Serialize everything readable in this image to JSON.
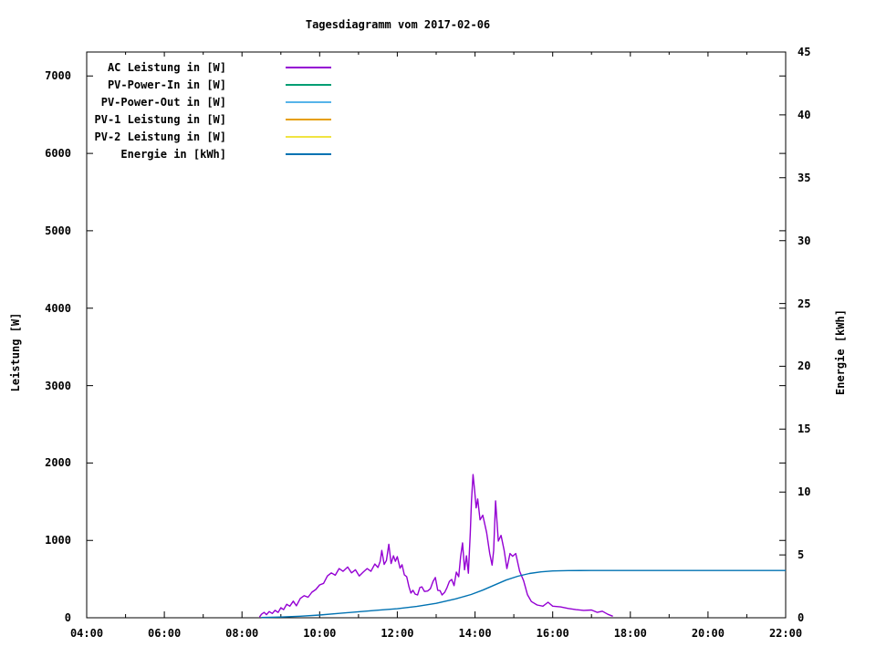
{
  "chart_data": {
    "type": "line",
    "title": "Tagesdiagramm vom 2017-02-06",
    "y1label": "Leistung [W]",
    "y2label": "Energie [kWh]",
    "background": "#ffffff",
    "grid": false,
    "legend_position": "top-left-inside",
    "x_range": [
      4,
      22
    ],
    "y1_range": [
      0,
      7310
    ],
    "y2_range": [
      0,
      45
    ],
    "x_ticks": [
      {
        "v": 4,
        "label": "04:00"
      },
      {
        "v": 6,
        "label": "06:00"
      },
      {
        "v": 8,
        "label": "08:00"
      },
      {
        "v": 10,
        "label": "10:00"
      },
      {
        "v": 12,
        "label": "12:00"
      },
      {
        "v": 14,
        "label": "14:00"
      },
      {
        "v": 16,
        "label": "16:00"
      },
      {
        "v": 18,
        "label": "18:00"
      },
      {
        "v": 20,
        "label": "20:00"
      },
      {
        "v": 22,
        "label": "22:00"
      }
    ],
    "x_minor": [
      5,
      7,
      9,
      11,
      13,
      15,
      17,
      19,
      21
    ],
    "y1_ticks": [
      {
        "v": 0,
        "label": "0"
      },
      {
        "v": 1000,
        "label": "1000"
      },
      {
        "v": 2000,
        "label": "2000"
      },
      {
        "v": 3000,
        "label": "3000"
      },
      {
        "v": 4000,
        "label": "4000"
      },
      {
        "v": 5000,
        "label": "5000"
      },
      {
        "v": 6000,
        "label": "6000"
      },
      {
        "v": 7000,
        "label": "7000"
      }
    ],
    "y2_ticks": [
      {
        "v": 0,
        "label": "0"
      },
      {
        "v": 5,
        "label": "5"
      },
      {
        "v": 10,
        "label": "10"
      },
      {
        "v": 15,
        "label": "15"
      },
      {
        "v": 20,
        "label": "20"
      },
      {
        "v": 25,
        "label": "25"
      },
      {
        "v": 30,
        "label": "30"
      },
      {
        "v": 35,
        "label": "35"
      },
      {
        "v": 40,
        "label": "40"
      },
      {
        "v": 45,
        "label": "45"
      }
    ],
    "series": [
      {
        "name": "AC Leistung in [W]",
        "color": "#9400D3",
        "axis": "y1",
        "points": [
          [
            8.45,
            10
          ],
          [
            8.5,
            45
          ],
          [
            8.57,
            70
          ],
          [
            8.63,
            40
          ],
          [
            8.7,
            80
          ],
          [
            8.78,
            55
          ],
          [
            8.85,
            95
          ],
          [
            8.93,
            70
          ],
          [
            9.0,
            130
          ],
          [
            9.07,
            105
          ],
          [
            9.15,
            175
          ],
          [
            9.23,
            150
          ],
          [
            9.32,
            215
          ],
          [
            9.4,
            155
          ],
          [
            9.5,
            250
          ],
          [
            9.6,
            285
          ],
          [
            9.7,
            265
          ],
          [
            9.8,
            330
          ],
          [
            9.9,
            365
          ],
          [
            10.0,
            425
          ],
          [
            10.1,
            445
          ],
          [
            10.2,
            540
          ],
          [
            10.3,
            580
          ],
          [
            10.4,
            550
          ],
          [
            10.5,
            635
          ],
          [
            10.6,
            600
          ],
          [
            10.72,
            655
          ],
          [
            10.82,
            580
          ],
          [
            10.92,
            620
          ],
          [
            11.02,
            540
          ],
          [
            11.12,
            590
          ],
          [
            11.22,
            635
          ],
          [
            11.32,
            600
          ],
          [
            11.42,
            695
          ],
          [
            11.5,
            650
          ],
          [
            11.56,
            730
          ],
          [
            11.6,
            870
          ],
          [
            11.66,
            690
          ],
          [
            11.72,
            740
          ],
          [
            11.78,
            950
          ],
          [
            11.84,
            700
          ],
          [
            11.9,
            800
          ],
          [
            11.95,
            730
          ],
          [
            12.0,
            790
          ],
          [
            12.07,
            640
          ],
          [
            12.12,
            685
          ],
          [
            12.18,
            555
          ],
          [
            12.24,
            530
          ],
          [
            12.3,
            400
          ],
          [
            12.35,
            320
          ],
          [
            12.4,
            355
          ],
          [
            12.46,
            305
          ],
          [
            12.52,
            295
          ],
          [
            12.58,
            390
          ],
          [
            12.63,
            400
          ],
          [
            12.7,
            340
          ],
          [
            12.78,
            345
          ],
          [
            12.85,
            375
          ],
          [
            12.92,
            470
          ],
          [
            12.98,
            520
          ],
          [
            13.04,
            355
          ],
          [
            13.1,
            350
          ],
          [
            13.15,
            295
          ],
          [
            13.22,
            330
          ],
          [
            13.28,
            390
          ],
          [
            13.34,
            470
          ],
          [
            13.4,
            495
          ],
          [
            13.46,
            415
          ],
          [
            13.52,
            590
          ],
          [
            13.58,
            530
          ],
          [
            13.63,
            790
          ],
          [
            13.68,
            967
          ],
          [
            13.73,
            620
          ],
          [
            13.78,
            800
          ],
          [
            13.83,
            575
          ],
          [
            13.88,
            1100
          ],
          [
            13.91,
            1510
          ],
          [
            13.95,
            1850
          ],
          [
            13.99,
            1650
          ],
          [
            14.03,
            1420
          ],
          [
            14.07,
            1535
          ],
          [
            14.13,
            1265
          ],
          [
            14.2,
            1325
          ],
          [
            14.3,
            1100
          ],
          [
            14.38,
            830
          ],
          [
            14.44,
            680
          ],
          [
            14.48,
            870
          ],
          [
            14.53,
            1510
          ],
          [
            14.6,
            990
          ],
          [
            14.67,
            1065
          ],
          [
            14.75,
            870
          ],
          [
            14.82,
            635
          ],
          [
            14.9,
            830
          ],
          [
            14.97,
            795
          ],
          [
            15.05,
            830
          ],
          [
            15.15,
            600
          ],
          [
            15.25,
            480
          ],
          [
            15.35,
            300
          ],
          [
            15.45,
            210
          ],
          [
            15.6,
            165
          ],
          [
            15.75,
            150
          ],
          [
            15.88,
            200
          ],
          [
            16.0,
            150
          ],
          [
            16.2,
            140
          ],
          [
            16.4,
            120
          ],
          [
            16.6,
            105
          ],
          [
            16.8,
            95
          ],
          [
            17.0,
            100
          ],
          [
            17.15,
            70
          ],
          [
            17.28,
            85
          ],
          [
            17.42,
            45
          ],
          [
            17.55,
            20
          ]
        ]
      },
      {
        "name": "PV-Power-In in [W]",
        "color": "#009E73",
        "axis": "y1",
        "points": []
      },
      {
        "name": "PV-Power-Out in [W]",
        "color": "#56B4E9",
        "axis": "y1",
        "points": []
      },
      {
        "name": "PV-1 Leistung in [W]",
        "color": "#E69F00",
        "axis": "y1",
        "points": []
      },
      {
        "name": "PV-2 Leistung in [W]",
        "color": "#F0E442",
        "axis": "y1",
        "points": []
      },
      {
        "name": "Energie in [kWh]",
        "color": "#0072B2",
        "axis": "y2",
        "points": [
          [
            8.5,
            0.02
          ],
          [
            9.0,
            0.06
          ],
          [
            9.5,
            0.12
          ],
          [
            10.0,
            0.22
          ],
          [
            10.5,
            0.35
          ],
          [
            11.0,
            0.48
          ],
          [
            11.5,
            0.6
          ],
          [
            12.0,
            0.72
          ],
          [
            12.5,
            0.9
          ],
          [
            13.0,
            1.15
          ],
          [
            13.5,
            1.5
          ],
          [
            13.9,
            1.85
          ],
          [
            14.2,
            2.2
          ],
          [
            14.5,
            2.6
          ],
          [
            14.8,
            3.0
          ],
          [
            15.1,
            3.3
          ],
          [
            15.4,
            3.52
          ],
          [
            15.7,
            3.65
          ],
          [
            16.0,
            3.72
          ],
          [
            16.4,
            3.75
          ],
          [
            17.0,
            3.76
          ],
          [
            18.0,
            3.76
          ],
          [
            20.0,
            3.76
          ],
          [
            22.0,
            3.76
          ]
        ]
      }
    ]
  }
}
